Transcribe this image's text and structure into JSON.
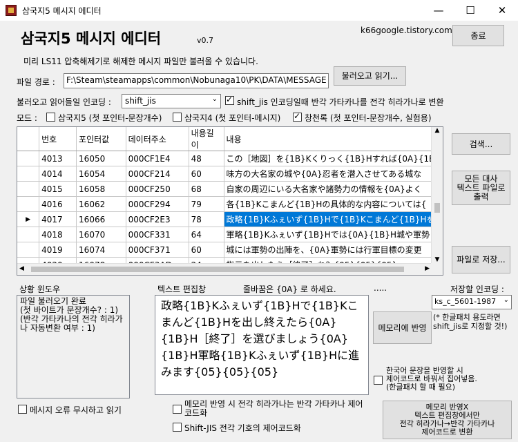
{
  "window": {
    "title": "삼국지5 메시지 에디터",
    "minimize": "—",
    "maximize": "☐",
    "close": "✕"
  },
  "header": {
    "app_title": "삼국지5 메시지 에디터",
    "version": "v0.7",
    "site": "k66google.tistory.com",
    "exit_label": "종료",
    "description": "미리 LS11 압축해제기로 해제한 메시지 파일만 불러올 수 있습니다."
  },
  "file": {
    "path_label": "파일 경로 :",
    "path_value": "F:\\Steam\\steamapps\\common\\Nobunaga10\\PK\\DATA\\MESSAGE",
    "load_label": "불러오고 읽기..."
  },
  "encoding": {
    "label": "불러오고 읽어들일 인코딩 :",
    "selected": "shift_jis",
    "convert_label": "shift_jis 인코딩일때 반각 가타카나를 전각 히라가나로 변환",
    "convert_checked": true
  },
  "mode": {
    "label": "모드 :",
    "options": [
      {
        "label": "삼국지5 (첫 포인터-문장개수)",
        "checked": false
      },
      {
        "label": "삼국지4 (첫 포인터-메시지)",
        "checked": false
      },
      {
        "label": "창천록 (첫 포인터-문장개수, 실험용)",
        "checked": true
      }
    ]
  },
  "table": {
    "columns": [
      "번호",
      "포인터값",
      "데이터주소",
      "내용길이",
      "내용"
    ],
    "selected_index": 4,
    "row_marker": "▶",
    "rows": [
      [
        "4013",
        "16050",
        "000CF1E4",
        "48",
        "この［地図］を{1B}Kくりっく{1B}Hすれば{0A}{1B}"
      ],
      [
        "4014",
        "16054",
        "000CF214",
        "60",
        "味方の大名家の城や{0A}忍者を潜入させてある城な"
      ],
      [
        "4015",
        "16058",
        "000CF250",
        "68",
        "自家の周辺にいる大名家や諸勢力の情報を{0A}よく"
      ],
      [
        "4016",
        "16062",
        "000CF294",
        "79",
        "各{1B}Kこまんど{1B}Hの具体的な内容については{"
      ],
      [
        "4017",
        "16066",
        "000CF2E3",
        "78",
        "政略{1B}Kふぇいず{1B}Hで{1B}Kこまんど{1B}Hを"
      ],
      [
        "4018",
        "16070",
        "000CF331",
        "64",
        "軍略{1B}Kふぇいず{1B}Hでは{0A}{1B}H城や軍勢"
      ],
      [
        "4019",
        "16074",
        "000CF371",
        "60",
        "城には軍勢の出陣を、{0A}軍勢には行軍目標の変更"
      ],
      [
        "4020",
        "16078",
        "000CF3AD",
        "24",
        "指示を出したら［終了］ね？{05}{05}{05}"
      ]
    ]
  },
  "side_buttons": {
    "search": "검색...",
    "export_all_line1": "모든 대사",
    "export_all_line2": "텍스트 파일로",
    "export_all_line3": "출력",
    "save_file": "파일로 저장..."
  },
  "status": {
    "label": "상황 윈도우",
    "text": "파일 불러오기 완료\n(첫 바이트가 문장개수? : 1)\n(반각 가타카나의 전각 히라가나 자동변환 여부 : 1)"
  },
  "editor": {
    "label": "텍스트 편집창",
    "hint": "줄바꿈은 {0A} 로 하세요.",
    "dots": ".....",
    "content": "政略{1B}Kふぇいず{1B}Hで{1B}Kこまんど{1B}Hを出し終えたら{0A}{1B}H［終了］を選びましょう{0A}{1B}H軍略{1B}Kふぇいず{1B}Hに進みます{05}{05}{05}"
  },
  "save_encoding": {
    "label": "저장할 인코딩 :",
    "selected": "ks_c_5601-1987",
    "note_line1": "(* 한글패치 용도라면",
    "note_line2": "shift_jis로 지정할 것!)"
  },
  "apply": {
    "memory_label": "메모리에 반영",
    "korean_check_line1": "한국어 문장을 반영할 시",
    "korean_check_line2": "제어코드로 바꿔서 집어넣음.",
    "korean_check_line3": "(한글패치 할 때 필요)",
    "convert_btn_line1": "메모리 반영X",
    "convert_btn_line2": "텍스트 편집창에서만",
    "convert_btn_line3": "전각 히라가나→반각 가타카나",
    "convert_btn_line4": "제어코드로 변환"
  },
  "bottom_checks": {
    "ignore_errors": "메시지 오류 무시하고 읽기",
    "hira_convert_line1": "메모리 반영 시 전각 히라가나는 반각 가타카나 제어",
    "hira_convert_line2": "코드화",
    "sjis_symbols": "Shift-JIS 전각 기호의 제어코드화"
  }
}
